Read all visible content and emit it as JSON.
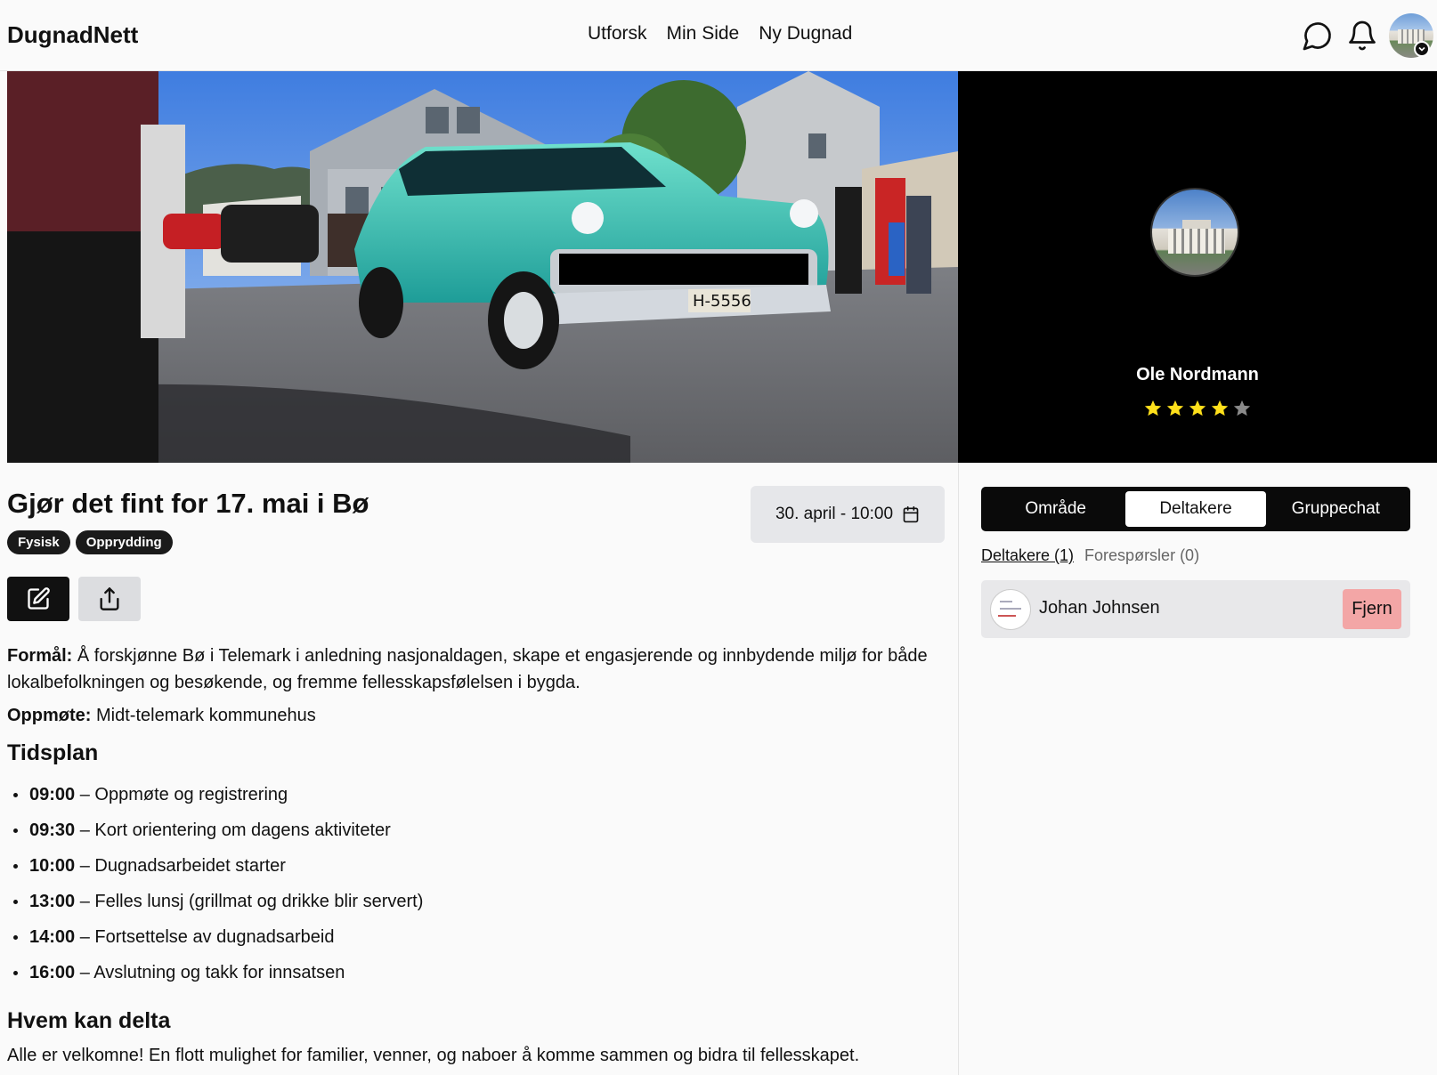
{
  "app": {
    "name": "DugnadNett"
  },
  "nav": {
    "items": [
      "Utforsk",
      "Min Side",
      "Ny Dugnad"
    ]
  },
  "header_icons": [
    "chat-bubble-icon",
    "bell-icon",
    "user-avatar"
  ],
  "event": {
    "title": "Gjør det fint for 17. mai i Bø",
    "tags": [
      "Fysisk",
      "Opprydding"
    ],
    "date": "30. april - 10:00",
    "purpose_label": "Formål:",
    "purpose_text": "Å forskjønne Bø i Telemark i anledning nasjonaldagen, skape et engasjerende og innbydende miljø for både lokalbefolkningen og besøkende, og fremme fellesskapsfølelsen i bygda.",
    "meeting_label": "Oppmøte:",
    "meeting_text": "Midt-telemark kommunehus",
    "schedule_heading": "Tidsplan",
    "schedule": [
      {
        "time": "09:00",
        "text": "– Oppmøte og registrering"
      },
      {
        "time": "09:30",
        "text": "– Kort orientering om dagens aktiviteter"
      },
      {
        "time": "10:00",
        "text": "– Dugnadsarbeidet starter"
      },
      {
        "time": "13:00",
        "text": "– Felles lunsj (grillmat og drikke blir servert)"
      },
      {
        "time": "14:00",
        "text": "– Fortsettelse av dugnadsarbeid"
      },
      {
        "time": "16:00",
        "text": "– Avslutning og takk for innsatsen"
      }
    ],
    "who_heading": "Hvem kan delta",
    "who_text": "Alle er velkomne! En flott mulighet for familier, venner, og naboer å komme sammen og bidra til fellesskapet."
  },
  "organizer": {
    "name": "Ole Nordmann",
    "rating": 4,
    "rating_max": 5
  },
  "right_tabs": {
    "items": [
      "Område",
      "Deltakere",
      "Gruppechat"
    ],
    "active": "Deltakere"
  },
  "participants_view": {
    "subtab_participants": "Deltakere (1)",
    "subtab_requests": "Forespørsler (0)",
    "list": [
      {
        "name": "Johan Johnsen",
        "action": "Fjern"
      }
    ]
  },
  "colors": {
    "star": "#ffe01b",
    "remove_button": "#f3a6a6",
    "dark": "#0a0a0a"
  }
}
